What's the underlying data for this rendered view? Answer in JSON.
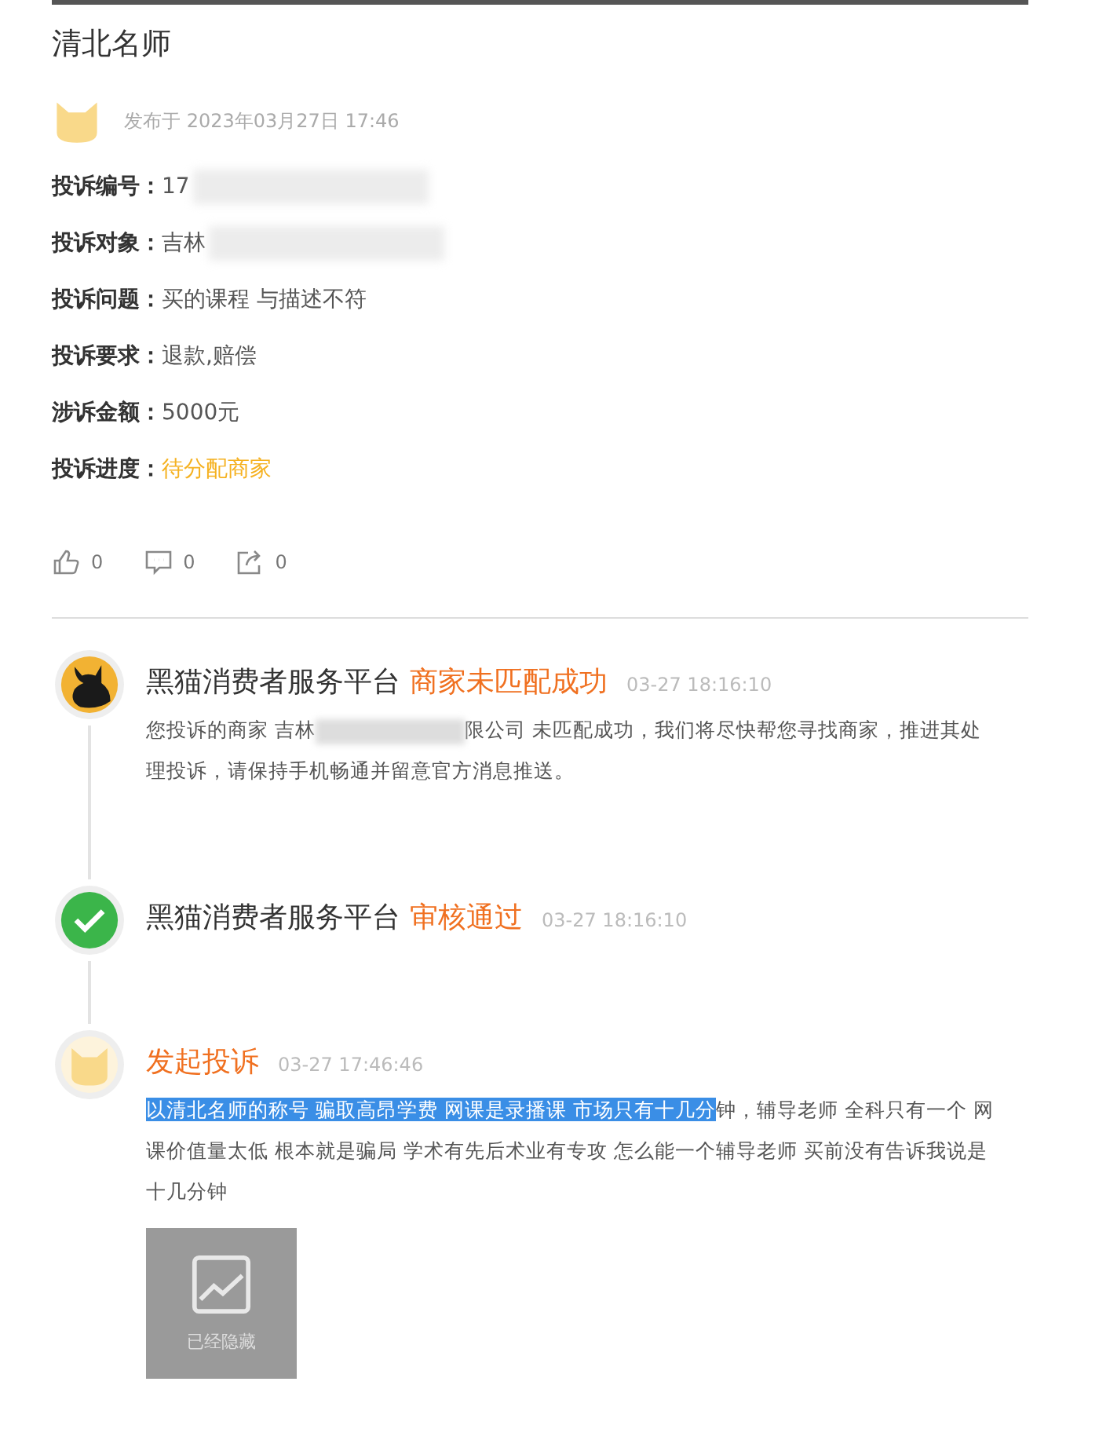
{
  "title": "清北名师",
  "author": {
    "published": "发布于 2023年03月27日 17:46"
  },
  "fields": [
    {
      "label": "投诉编号：",
      "value": "17",
      "redacted": true,
      "status": false
    },
    {
      "label": "投诉对象：",
      "value": "吉林",
      "redacted": true,
      "status": false
    },
    {
      "label": "投诉问题：",
      "value": "买的课程 与描述不符",
      "redacted": false,
      "status": false
    },
    {
      "label": "投诉要求：",
      "value": "退款,赔偿",
      "redacted": false,
      "status": false
    },
    {
      "label": "涉诉金额：",
      "value": "5000元",
      "redacted": false,
      "status": false
    },
    {
      "label": "投诉进度：",
      "value": "待分配商家",
      "redacted": false,
      "status": true
    }
  ],
  "actions": [
    {
      "kind": "like",
      "count": "0"
    },
    {
      "kind": "comment",
      "count": "0"
    },
    {
      "kind": "share",
      "count": "0"
    }
  ],
  "timeline": [
    {
      "kind": "platform",
      "name": "黑猫消费者服务平台",
      "status": "商家未匹配成功",
      "time": "03-27 18:16:10",
      "before": "您投诉的商家 吉林",
      "after": "限公司 未匹配成功，我们将尽快帮您寻找商家，推进其处理投诉，请保持手机畅通并留意官方消息推送。"
    },
    {
      "kind": "approved",
      "name": "黑猫消费者服务平台",
      "status": "审核通过",
      "time": "03-27 18:16:10"
    },
    {
      "kind": "user",
      "status": "发起投诉",
      "time": "03-27 17:46:46",
      "highlighted": "以清北名师的称号 骗取高昂学费 网课是录播课 市场只有十几分",
      "text": "钟，辅导老师 全科只有一个 网课价值量太低 根本就是骗局 学术有先后术业有专攻 怎么能一个辅导老师 买前没有告诉我说是十几分钟",
      "image": {
        "label": "已经隐藏"
      }
    }
  ]
}
